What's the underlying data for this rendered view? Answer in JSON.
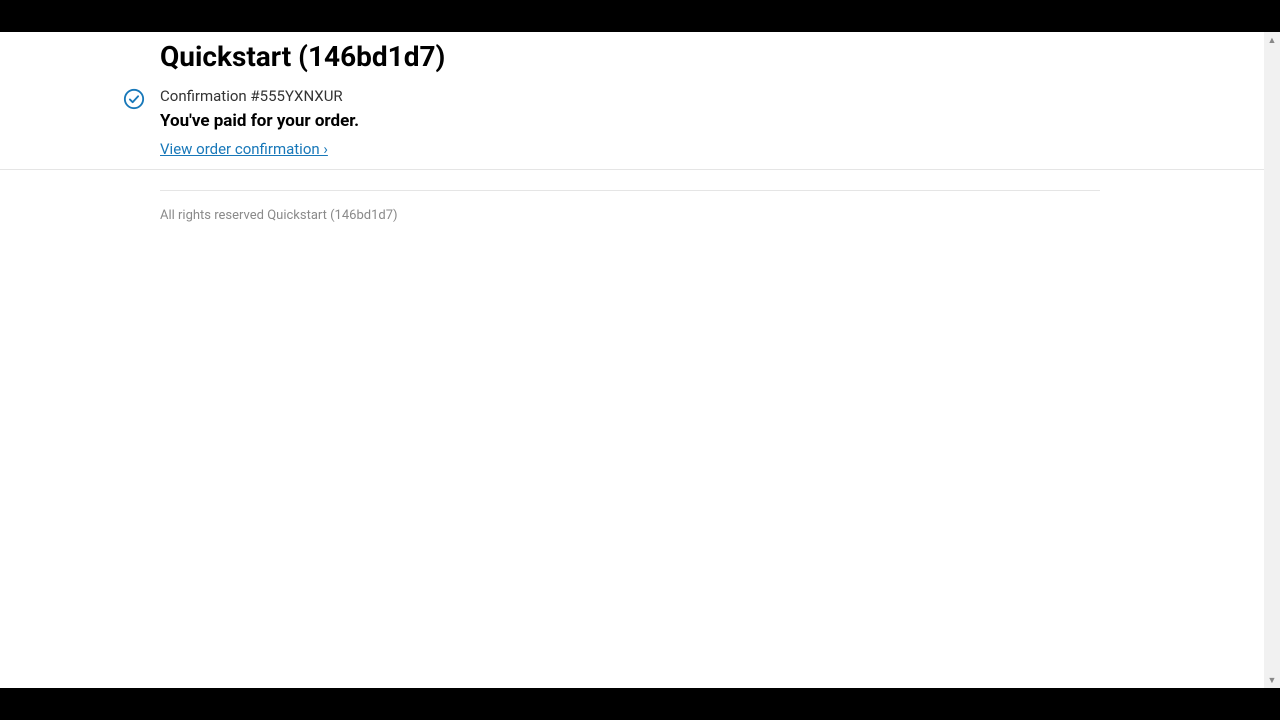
{
  "header": {
    "title": "Quickstart (146bd1d7)"
  },
  "confirmation": {
    "number_label": "Confirmation #555YXNXUR",
    "paid_message": "You've paid for your order.",
    "view_link": "View order confirmation ›"
  },
  "footer": {
    "rights": "All rights reserved Quickstart (146bd1d7)"
  }
}
